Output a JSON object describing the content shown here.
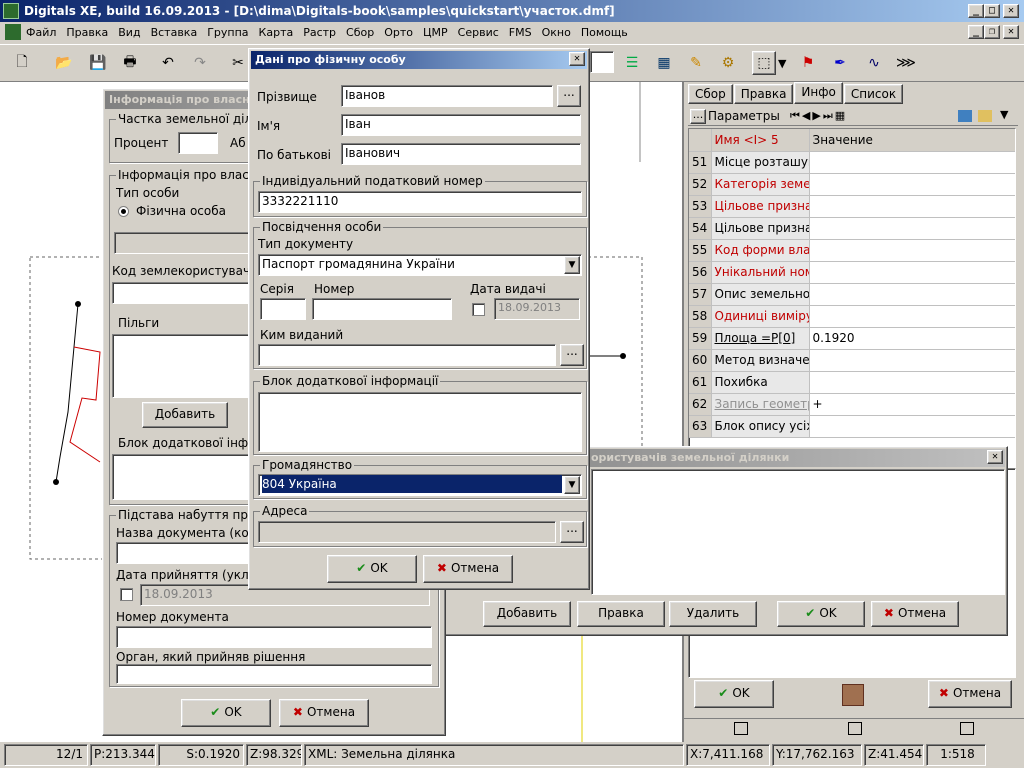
{
  "window": {
    "title": "Digitals XE, build 16.09.2013 - [D:\\dima\\Digitals-book\\samples\\quickstart\\участок.dmf]",
    "minimize": "_",
    "maximize": "□",
    "close": "✕"
  },
  "menu": [
    "Файл",
    "Правка",
    "Вид",
    "Вставка",
    "Группа",
    "Карта",
    "Растр",
    "Сбор",
    "Орто",
    "ЦМР",
    "Сервис",
    "FMS",
    "Окно",
    "Помощь"
  ],
  "toolbar": {
    "new": "new-doc-icon",
    "open": "open-folder-icon",
    "save": "save-icon",
    "print": "print-icon",
    "undo": "undo-icon",
    "redo": "redo-icon",
    "cut": "cut-icon"
  },
  "owner_dialog": {
    "title": "Інформація про власників",
    "share_group": "Частка земельної ділянки",
    "share_label": "Процент",
    "share_label2": "Аб",
    "owner_group": "Інформація про власника",
    "type_group": "Тип особи",
    "radio_person": "Фізична особа",
    "code_label": "Код землекористувача",
    "benefits_group": "Пільги",
    "add_button": "Добавить",
    "extra_group": "Блок додаткової інформації",
    "basis_group": "Підстава набуття права",
    "doc_name_label": "Назва документа (код)",
    "accept_date_label": "Дата прийняття (укладення)",
    "accept_date": "18.09.2013",
    "doc_number_label": "Номер документа",
    "organ_label": "Орган, який прийняв рішення",
    "ok": "OK",
    "cancel": "Отмена"
  },
  "person_dialog": {
    "title": "Дані про фізичну особу",
    "surname_label": "Прізвище",
    "surname": "Іванов",
    "name_label": "Ім'я",
    "name": "Іван",
    "patronymic_label": "По батькові",
    "patronymic": "Іванович",
    "tax_group": "Індивідуальний податковий номер",
    "tax_number": "3332221110",
    "id_group": "Посвідчення особи",
    "doc_type_label": "Тип документу",
    "doc_type": "Паспорт громадянина України",
    "series_label": "Серія",
    "number_label": "Номер",
    "issue_date_label": "Дата видачі",
    "issue_date": "18.09.2013",
    "issued_by_label": "Ким виданий",
    "extra_group": "Блок додаткової інформації",
    "citizenship_group": "Громадянство",
    "citizenship": "804 Україна",
    "address_group": "Адреса",
    "ellipsis": "...",
    "ok": "OK",
    "cancel": "Отмена"
  },
  "users_dialog": {
    "title": "ористувачів земельної ділянки",
    "add": "Добавить",
    "edit": "Правка",
    "delete": "Удалить",
    "ok": "OK",
    "cancel": "Отмена"
  },
  "right_panel": {
    "tabs": [
      "Сбор",
      "Правка",
      "Инфо",
      "Список"
    ],
    "params_label": "Параметры",
    "col_name": "Имя <I> 5",
    "col_value": "Значение",
    "rows": [
      {
        "n": "51",
        "name": "Місце розташування",
        "value": "",
        "style": "normal"
      },
      {
        "n": "52",
        "name": "Категорія земель",
        "value": "",
        "style": "red"
      },
      {
        "n": "53",
        "name": "Цільове призначення",
        "value": "",
        "style": "red"
      },
      {
        "n": "54",
        "name": "Цільове призначення",
        "value": "",
        "style": "normal"
      },
      {
        "n": "55",
        "name": "Код форми власності",
        "value": "",
        "style": "red"
      },
      {
        "n": "56",
        "name": "Унікальний номер",
        "value": "",
        "style": "red"
      },
      {
        "n": "57",
        "name": "Опис земельної ділянки",
        "value": "",
        "style": "normal"
      },
      {
        "n": "58",
        "name": "Одиниці виміру",
        "value": "",
        "style": "red"
      },
      {
        "n": "59",
        "name": "Площа =P[0]",
        "value": "0.1920",
        "style": "underline"
      },
      {
        "n": "60",
        "name": "Метод визначення",
        "value": "",
        "style": "normal"
      },
      {
        "n": "61",
        "name": "Похибка",
        "value": "",
        "style": "normal"
      },
      {
        "n": "62",
        "name": "Запись геометрії",
        "value": "+",
        "style": "gray"
      },
      {
        "n": "63",
        "name": "Блок опису усіх",
        "value": "",
        "style": "normal"
      }
    ],
    "ok": "OK",
    "cancel": "Отмена"
  },
  "status": {
    "page": "12/1",
    "p": "P:213.344",
    "s": "S:0.1920",
    "z": "Z:98.329",
    "xml": "XML: Земельна ділянка",
    "x": "X:7,411.168",
    "y": "Y:17,762.163",
    "z2": "Z:41.454",
    "scale": "1:518"
  }
}
